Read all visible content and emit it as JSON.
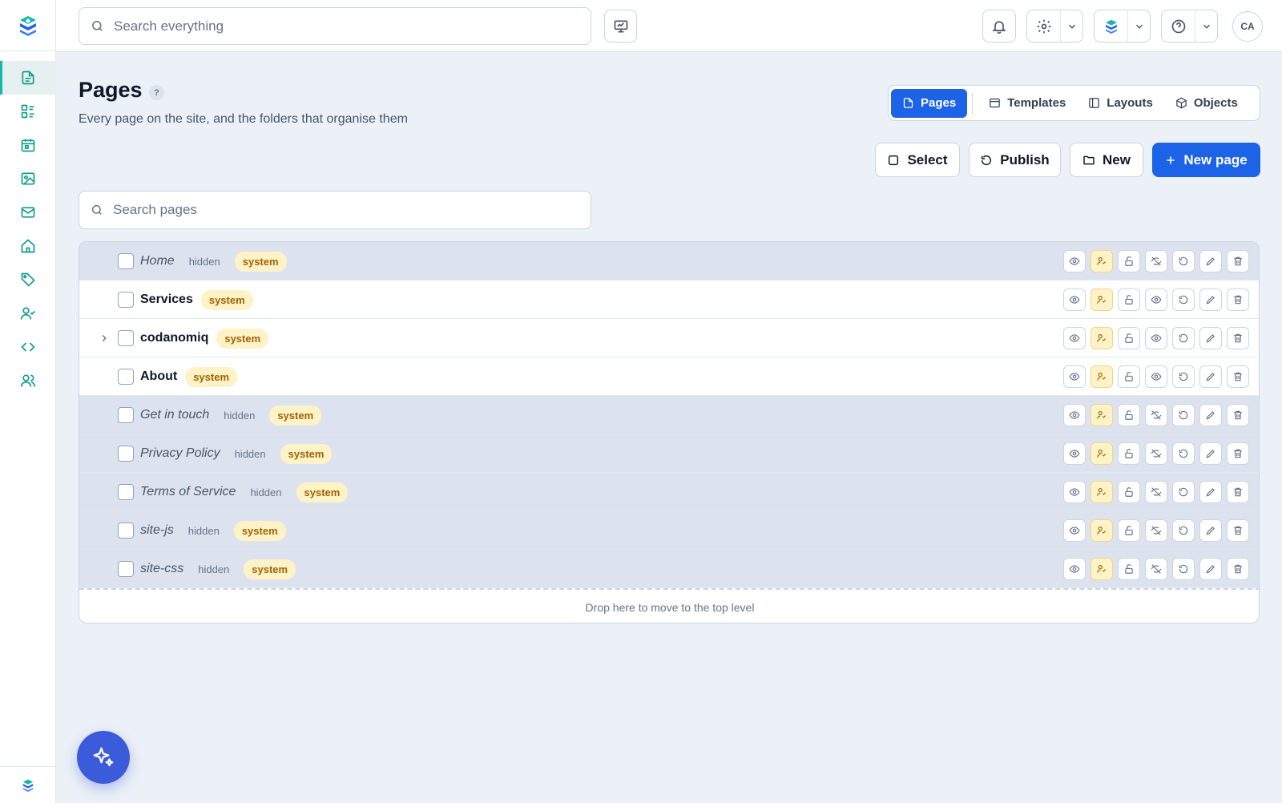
{
  "topbar": {
    "search_placeholder": "Search everything",
    "avatar_initials": "CA"
  },
  "page": {
    "title": "Pages",
    "help": "?",
    "subtitle": "Every page on the site, and the folders that organise them"
  },
  "tabs": [
    {
      "label": "Pages",
      "icon": "file-icon",
      "active": true
    },
    {
      "label": "Templates",
      "icon": "template-icon",
      "active": false
    },
    {
      "label": "Layouts",
      "icon": "layout-icon",
      "active": false
    },
    {
      "label": "Objects",
      "icon": "cube-icon",
      "active": false
    }
  ],
  "actions": {
    "select_label": "Select",
    "publish_label": "Publish",
    "new_label": "New",
    "new_page_label": "New page"
  },
  "page_search_placeholder": "Search pages",
  "tags": {
    "hidden": "hidden",
    "system": "system"
  },
  "rows": [
    {
      "name": "Home",
      "hidden": true,
      "expandable": false
    },
    {
      "name": "Services",
      "hidden": false,
      "expandable": false
    },
    {
      "name": "codanomiq",
      "hidden": false,
      "expandable": true
    },
    {
      "name": "About",
      "hidden": false,
      "expandable": false
    },
    {
      "name": "Get in touch",
      "hidden": true,
      "expandable": false
    },
    {
      "name": "Privacy Policy",
      "hidden": true,
      "expandable": false
    },
    {
      "name": "Terms of Service",
      "hidden": true,
      "expandable": false
    },
    {
      "name": "site-js",
      "hidden": true,
      "expandable": false
    },
    {
      "name": "site-css",
      "hidden": true,
      "expandable": false
    }
  ],
  "drop_zone_text": "Drop here to move to the top level",
  "sidebar_items": [
    "pages-icon",
    "forms-icon",
    "calendar-icon",
    "image-icon",
    "mail-icon",
    "home-icon",
    "tag-icon",
    "user-check-icon",
    "code-icon",
    "users-icon"
  ],
  "colors": {
    "accent": "#1d63e8",
    "teal": "#0f9d8a",
    "system_bg": "#fef3c7",
    "system_text": "#a16207",
    "hidden_row_bg": "#dde3ee"
  }
}
